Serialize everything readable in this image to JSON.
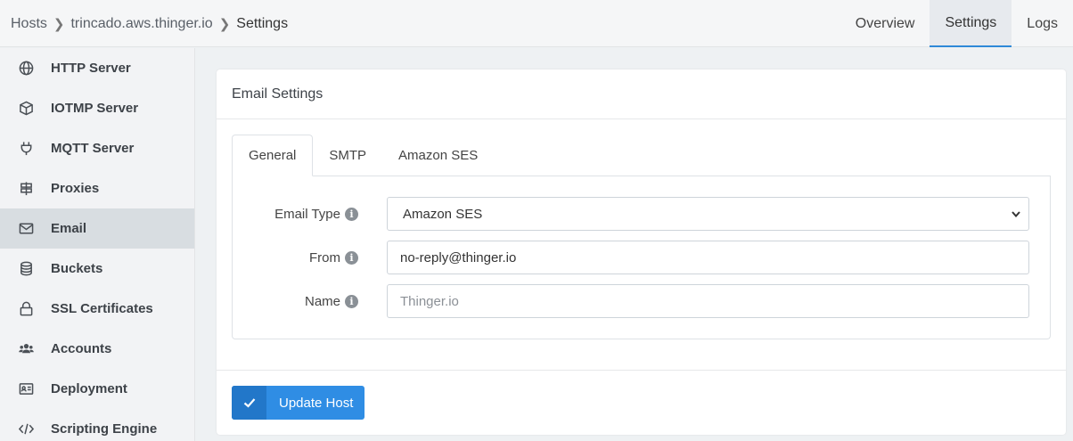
{
  "breadcrumb": {
    "items": [
      "Hosts",
      "trincado.aws.thinger.io",
      "Settings"
    ]
  },
  "top_tabs": [
    {
      "label": "Overview",
      "active": false
    },
    {
      "label": "Settings",
      "active": true
    },
    {
      "label": "Logs",
      "active": false
    }
  ],
  "sidebar": {
    "items": [
      {
        "label": "HTTP Server",
        "icon": "globe-icon"
      },
      {
        "label": "IOTMP Server",
        "icon": "cube-icon"
      },
      {
        "label": "MQTT Server",
        "icon": "plug-icon"
      },
      {
        "label": "Proxies",
        "icon": "signpost-icon"
      },
      {
        "label": "Email",
        "icon": "envelope-icon",
        "active": true
      },
      {
        "label": "Buckets",
        "icon": "database-icon"
      },
      {
        "label": "SSL Certificates",
        "icon": "lock-icon"
      },
      {
        "label": "Accounts",
        "icon": "users-icon"
      },
      {
        "label": "Deployment",
        "icon": "id-card-icon"
      },
      {
        "label": "Scripting Engine",
        "icon": "code-icon"
      }
    ]
  },
  "card": {
    "title": "Email Settings",
    "tabs": [
      {
        "label": "General",
        "active": true
      },
      {
        "label": "SMTP",
        "active": false
      },
      {
        "label": "Amazon SES",
        "active": false
      }
    ],
    "fields": {
      "email_type": {
        "label": "Email Type",
        "value": "Amazon SES"
      },
      "from": {
        "label": "From",
        "value": "no-reply@thinger.io"
      },
      "name": {
        "label": "Name",
        "placeholder": "Thinger.io"
      }
    },
    "info_glyph": "i",
    "submit_label": "Update Host"
  },
  "colors": {
    "accent": "#2f8de4",
    "accent_dark": "#2277c9",
    "active_tab_underline": "#2f89d8"
  }
}
